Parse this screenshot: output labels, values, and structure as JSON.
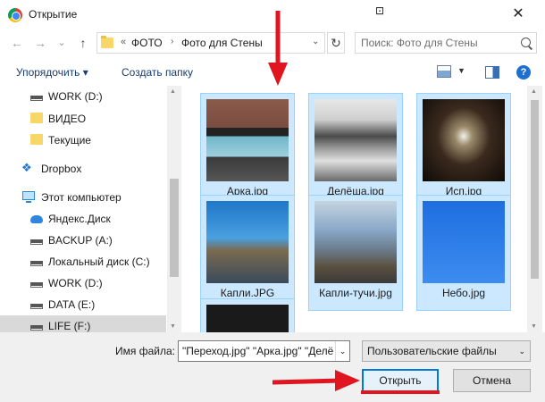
{
  "window": {
    "title": "Открытие",
    "close_glyph": "✕",
    "pin_glyph": "⊡"
  },
  "nav": {
    "back": "←",
    "forward": "→",
    "recent": "⌄",
    "up": "↑",
    "breadcrumb_overflow": "«",
    "crumbs": [
      "ФОТО",
      "Фото для Стены"
    ],
    "chevron": "›",
    "dropdown": "⌄",
    "refresh": "↻",
    "search_placeholder": "Поиск: Фото для Стены"
  },
  "toolbar": {
    "organize": "Упорядочить ▾",
    "new_folder": "Создать папку",
    "view_dropdown": "▼",
    "help": "?"
  },
  "sidebar": {
    "items": [
      {
        "label": "WORK (D:)",
        "icon": "drive-icon"
      },
      {
        "label": "ВИДЕО",
        "icon": "folder-icon"
      },
      {
        "label": "Текущие",
        "icon": "folder-icon"
      },
      {
        "label": "Dropbox",
        "icon": "dropbox-icon"
      },
      {
        "label": "Этот компьютер",
        "icon": "computer-icon"
      },
      {
        "label": "Яндекс.Диск",
        "icon": "cloud-icon"
      },
      {
        "label": "BACKUP (A:)",
        "icon": "drive-icon"
      },
      {
        "label": "Локальный диск (C:)",
        "icon": "drive-icon"
      },
      {
        "label": "WORK (D:)",
        "icon": "drive-icon"
      },
      {
        "label": "DATA (E:)",
        "icon": "drive-icon"
      },
      {
        "label": "LIFE (F:)",
        "icon": "drive-icon"
      }
    ],
    "scroll_up": "▲",
    "scroll_down": "▼"
  },
  "files": [
    {
      "name": "Арка.jpg",
      "selected": true
    },
    {
      "name": "Делёша.jpg",
      "selected": true
    },
    {
      "name": "Исп.jpg",
      "selected": true
    },
    {
      "name": "Капли.JPG",
      "selected": true
    },
    {
      "name": "Капли-тучи.jpg",
      "selected": true
    },
    {
      "name": "Небо.jpg",
      "selected": true
    },
    {
      "name": "",
      "selected": true
    }
  ],
  "footer": {
    "filename_label": "Имя файла:",
    "filename_value": "\"Переход.jpg\" \"Арка.jpg\" \"Делё",
    "filetype": "Пользовательские файлы",
    "open_button": "Открыть",
    "cancel_button": "Отмена",
    "dropdown_glyph": "⌄"
  },
  "annotations": {
    "arrow_color": "#e0151f"
  }
}
